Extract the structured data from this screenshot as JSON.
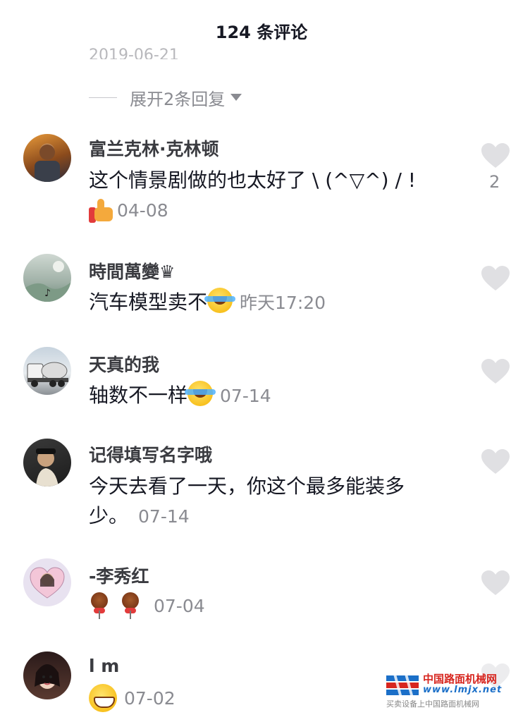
{
  "header": {
    "title": "124 条评论"
  },
  "cut_text": "2019-06-21",
  "expand": {
    "label": "展开2条回复"
  },
  "comments": [
    {
      "user": "富兰克林·克林顿",
      "text": "这个情景剧做的也太好了 \\ (^▽^) / !",
      "date": "04-08",
      "likes": "2",
      "emoji": "thumbs-up-icon",
      "avatar": "avatar-franklin"
    },
    {
      "user": "時間萬變♛",
      "text": "汽车模型卖不",
      "date": "昨天17:20",
      "likes": "",
      "emoji": "laughing-tears-icon",
      "avatar": "avatar-landscape"
    },
    {
      "user": "天真的我",
      "text": "轴数不一样",
      "date": "07-14",
      "likes": "",
      "emoji": "laughing-tears-icon",
      "avatar": "avatar-truck"
    },
    {
      "user": "记得填写名字哦",
      "text": "今天去看了一天，你这个最多能装多",
      "text2": "少。",
      "date": "07-14",
      "likes": "",
      "emoji": "",
      "avatar": "avatar-man"
    },
    {
      "user": "-李秀红",
      "text": "",
      "date": "07-04",
      "likes": "",
      "emoji": "lollipop-icon",
      "avatar": "avatar-heart-girl"
    },
    {
      "user": "l m",
      "text": "",
      "date": "07-02",
      "likes": "",
      "emoji": "grin-icon",
      "avatar": "avatar-girl"
    }
  ],
  "watermark": {
    "line1": "中国路面机械网",
    "line2": "www.lmjx.net",
    "line3": "买卖设备上中国路面机械网"
  },
  "colors": {
    "primary_text": "#161823",
    "secondary_text": "#8a8b91",
    "heart": "#e0e0e3",
    "watermark_red": "#d7261f",
    "watermark_blue": "#1b6fc8"
  }
}
